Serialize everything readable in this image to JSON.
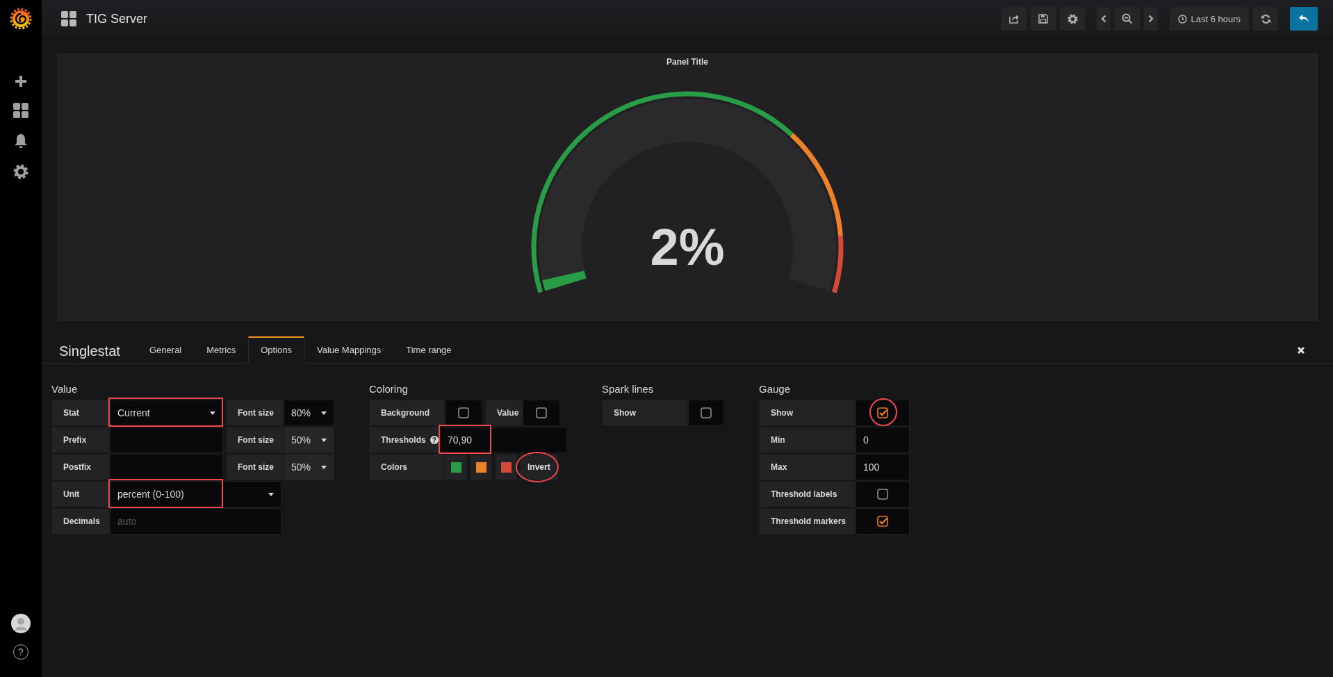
{
  "sidebar": {
    "help": "?"
  },
  "topbar": {
    "title": "TIG Server",
    "time_range": "Last 6 hours"
  },
  "panel": {
    "title": "Panel Title",
    "value": "2%",
    "level": 0.02
  },
  "editor": {
    "title": "Singlestat",
    "tabs": [
      {
        "label": "General",
        "selected": false
      },
      {
        "label": "Metrics",
        "selected": false
      },
      {
        "label": "Options",
        "selected": true
      },
      {
        "label": "Value Mappings",
        "selected": false
      },
      {
        "label": "Time range",
        "selected": false
      }
    ]
  },
  "value_section": {
    "heading": "Value",
    "rows": [
      {
        "label": "Stat",
        "field": {
          "kind": "select",
          "value": "Current",
          "annotated": true
        },
        "font_size": {
          "label": "Font size",
          "value": "80%"
        }
      },
      {
        "label": "Prefix",
        "field": {
          "kind": "input"
        },
        "font_size": {
          "label": "Font size",
          "value": "50%"
        }
      },
      {
        "label": "Postfix",
        "field": {
          "kind": "input"
        },
        "font_size": {
          "label": "Font size",
          "value": "50%"
        }
      },
      {
        "label": "Unit",
        "field": {
          "kind": "select",
          "value": "percent (0-100)",
          "annotated": true
        }
      },
      {
        "label": "Decimals",
        "field": {
          "kind": "input",
          "placeholder": "auto"
        }
      }
    ]
  },
  "coloring": {
    "heading": "Coloring",
    "toggles": [
      {
        "label": "Background",
        "checked": false
      },
      {
        "label": "Value",
        "checked": false
      }
    ],
    "thresholds": {
      "label": "Thresholds",
      "help": "?",
      "value": "70,90",
      "annotated": true
    },
    "colors_label": "Colors",
    "colors": [
      {
        "color": "#299c46"
      },
      {
        "color": "#ed8128"
      },
      {
        "color": "#d44a3a"
      }
    ],
    "invert": {
      "label": "Invert",
      "annotated": true
    }
  },
  "spark_lines": {
    "heading": "Spark lines",
    "rows": [
      {
        "kind": "checkbox",
        "label": "Show",
        "checked": false
      }
    ]
  },
  "gauge": {
    "heading": "Gauge",
    "rows": [
      {
        "kind": "checkbox",
        "label": "Show",
        "checked": true,
        "annotated": true
      },
      {
        "kind": "input",
        "label": "Min",
        "value": "0"
      },
      {
        "kind": "input",
        "label": "Max",
        "value": "100"
      },
      {
        "kind": "checkbox",
        "label": "Threshold labels",
        "checked": false
      },
      {
        "kind": "checkbox",
        "label": "Threshold markers",
        "checked": true
      }
    ]
  }
}
